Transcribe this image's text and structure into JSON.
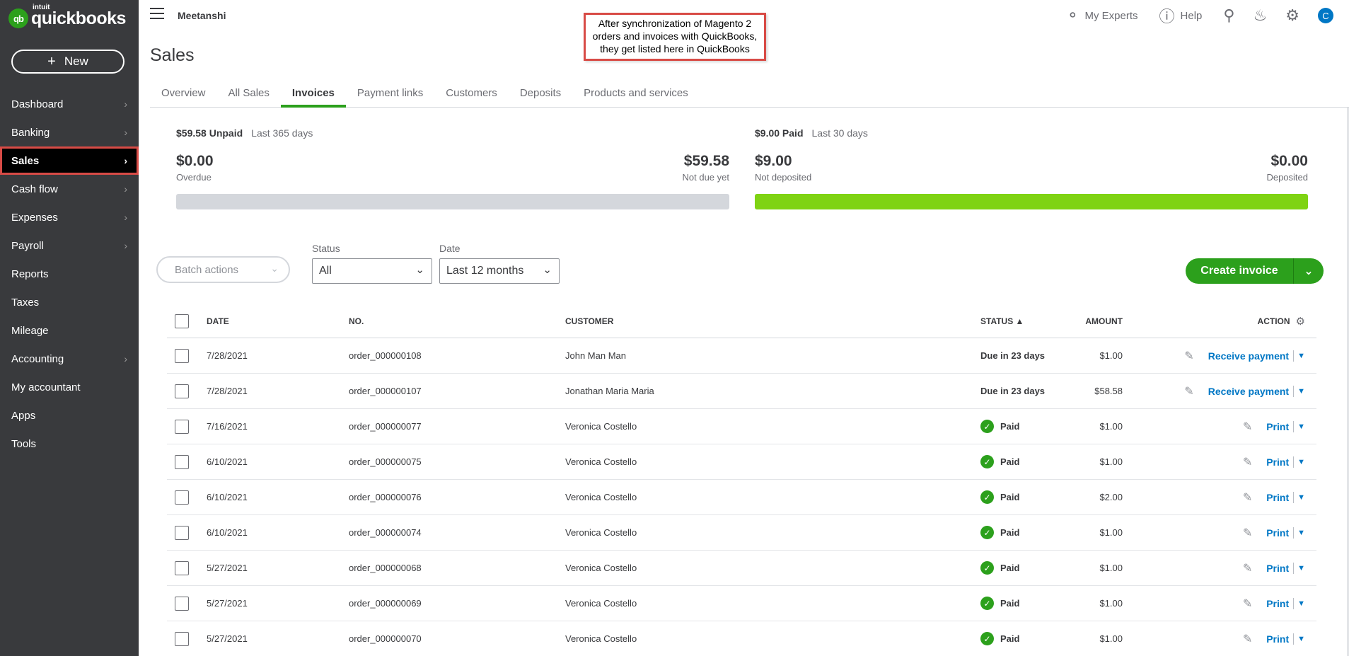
{
  "sidebar": {
    "logo_intuit": "intuit",
    "logo_brand": "quickbooks",
    "logo_badge": "qb",
    "new_label": "New",
    "items": [
      {
        "label": "Dashboard",
        "chevron": true
      },
      {
        "label": "Banking",
        "chevron": true
      },
      {
        "label": "Sales",
        "chevron": true,
        "active": true
      },
      {
        "label": "Cash flow",
        "chevron": true
      },
      {
        "label": "Expenses",
        "chevron": true
      },
      {
        "label": "Payroll",
        "chevron": true
      },
      {
        "label": "Reports",
        "chevron": false
      },
      {
        "label": "Taxes",
        "chevron": false
      },
      {
        "label": "Mileage",
        "chevron": false
      },
      {
        "label": "Accounting",
        "chevron": true
      },
      {
        "label": "My accountant",
        "chevron": false
      },
      {
        "label": "Apps",
        "chevron": false
      },
      {
        "label": "Tools",
        "chevron": false
      }
    ]
  },
  "topbar": {
    "company": "Meetanshi",
    "my_experts": "My Experts",
    "help": "Help",
    "avatar_initial": "C"
  },
  "annotation": "After synchronization of Magento 2 orders and invoices with QuickBooks, they get listed here in QuickBooks",
  "page_title": "Sales",
  "tabs": [
    "Overview",
    "All Sales",
    "Invoices",
    "Payment links",
    "Customers",
    "Deposits",
    "Products and services"
  ],
  "active_tab": "Invoices",
  "unpaid": {
    "headline": "$59.58 Unpaid",
    "period": "Last 365 days",
    "left_amount": "$0.00",
    "left_label": "Overdue",
    "right_amount": "$59.58",
    "right_label": "Not due yet",
    "fill_fraction": 0
  },
  "paid": {
    "headline": "$9.00 Paid",
    "period": "Last 30 days",
    "left_amount": "$9.00",
    "left_label": "Not deposited",
    "right_amount": "$0.00",
    "right_label": "Deposited",
    "fill_fraction": 1
  },
  "filters": {
    "batch_actions": "Batch actions",
    "status_label": "Status",
    "status_value": "All",
    "date_label": "Date",
    "date_value": "Last 12 months",
    "create_invoice": "Create invoice"
  },
  "table": {
    "headers": {
      "date": "DATE",
      "no": "NO.",
      "customer": "CUSTOMER",
      "amount": "AMOUNT",
      "status": "STATUS ▲",
      "action": "ACTION"
    },
    "rows": [
      {
        "date": "7/28/2021",
        "no": "order_000000108",
        "customer": "John Man Man",
        "amount": "$1.00",
        "status": "Due in 23 days",
        "paid": false,
        "action": "Receive payment"
      },
      {
        "date": "7/28/2021",
        "no": "order_000000107",
        "customer": "Jonathan Maria Maria",
        "amount": "$58.58",
        "status": "Due in 23 days",
        "paid": false,
        "action": "Receive payment"
      },
      {
        "date": "7/16/2021",
        "no": "order_000000077",
        "customer": "Veronica Costello",
        "amount": "$1.00",
        "status": "Paid",
        "paid": true,
        "action": "Print"
      },
      {
        "date": "6/10/2021",
        "no": "order_000000075",
        "customer": "Veronica Costello",
        "amount": "$1.00",
        "status": "Paid",
        "paid": true,
        "action": "Print"
      },
      {
        "date": "6/10/2021",
        "no": "order_000000076",
        "customer": "Veronica Costello",
        "amount": "$2.00",
        "status": "Paid",
        "paid": true,
        "action": "Print"
      },
      {
        "date": "6/10/2021",
        "no": "order_000000074",
        "customer": "Veronica Costello",
        "amount": "$1.00",
        "status": "Paid",
        "paid": true,
        "action": "Print"
      },
      {
        "date": "5/27/2021",
        "no": "order_000000068",
        "customer": "Veronica Costello",
        "amount": "$1.00",
        "status": "Paid",
        "paid": true,
        "action": "Print"
      },
      {
        "date": "5/27/2021",
        "no": "order_000000069",
        "customer": "Veronica Costello",
        "amount": "$1.00",
        "status": "Paid",
        "paid": true,
        "action": "Print"
      },
      {
        "date": "5/27/2021",
        "no": "order_000000070",
        "customer": "Veronica Costello",
        "amount": "$1.00",
        "status": "Paid",
        "paid": true,
        "action": "Print"
      }
    ]
  },
  "colors": {
    "sidebar_bg": "#393a3d",
    "accent_green": "#2ca01c",
    "link_blue": "#0077c5",
    "highlight_red": "#d84b46",
    "bar_green": "#7fd313"
  },
  "icons": {
    "menu": "hamburger-icon",
    "experts": "person-icon",
    "help": "question-icon",
    "search": "search-icon",
    "notifications": "bell-icon",
    "settings": "gear-icon"
  }
}
